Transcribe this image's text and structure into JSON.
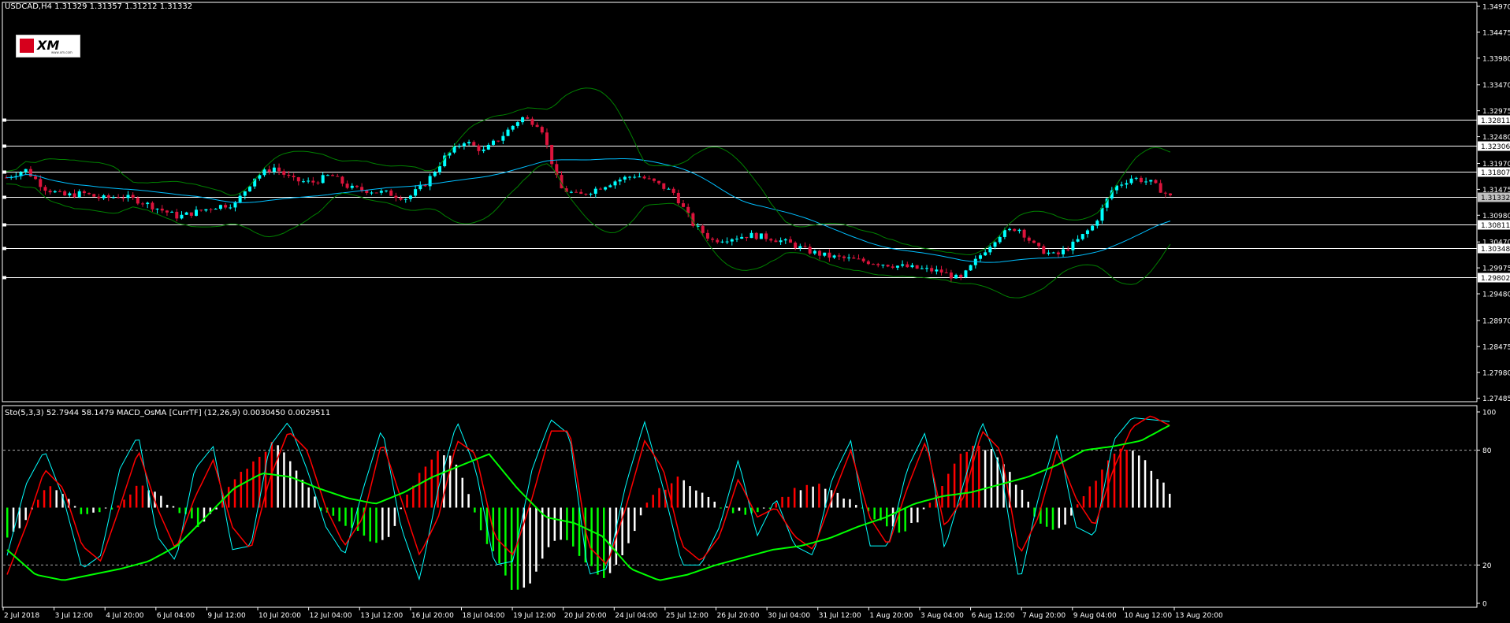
{
  "header": {
    "title": "USDCAD,H4  1.31329 1.31357 1.31212 1.31332",
    "indicator_title": "Sto(5,3,3) 52.7944 58.1479  MACD_OsMA [CurrTF] (12,26,9) 0.0030450 0.0029511",
    "logo_text": "XM",
    "logo_sub": "www.xm.com"
  },
  "chart_data": [
    {
      "type": "candlestick",
      "symbol": "USDCAD",
      "timeframe": "H4",
      "ylim": [
        1.2745,
        1.35
      ],
      "price_ticks": [
        "1.34970",
        "1.34475",
        "1.33980",
        "1.33470",
        "1.32975",
        "1.32480",
        "1.31970",
        "1.31475",
        "1.30980",
        "1.30470",
        "1.29975",
        "1.29480",
        "1.28970",
        "1.28475",
        "1.27980",
        "1.27485"
      ],
      "horizontal_levels": [
        "1.32811",
        "1.32306",
        "1.31807",
        "1.31332",
        "1.30811",
        "1.30348",
        "1.29802"
      ],
      "current_price": "1.31332",
      "x_labels": [
        "2 Jul 2018",
        "3 Jul 12:00",
        "4 Jul 20:00",
        "6 Jul 04:00",
        "9 Jul 12:00",
        "10 Jul 20:00",
        "12 Jul 04:00",
        "13 Jul 12:00",
        "16 Jul 20:00",
        "18 Jul 04:00",
        "19 Jul 12:00",
        "20 Jul 20:00",
        "24 Jul 04:00",
        "25 Jul 12:00",
        "26 Jul 20:00",
        "30 Jul 04:00",
        "31 Jul 12:00",
        "1 Aug 20:00",
        "3 Aug 04:00",
        "6 Aug 12:00",
        "7 Aug 20:00",
        "9 Aug 04:00",
        "10 Aug 12:00",
        "13 Aug 20:00"
      ],
      "close_path": [
        1.317,
        1.3185,
        1.315,
        1.3135,
        1.314,
        1.313,
        1.3135,
        1.3125,
        1.311,
        1.3095,
        1.3105,
        1.3115,
        1.312,
        1.317,
        1.319,
        1.3165,
        1.316,
        1.3175,
        1.315,
        1.3145,
        1.314,
        1.313,
        1.316,
        1.321,
        1.324,
        1.322,
        1.325,
        1.3285,
        1.327,
        1.315,
        1.3135,
        1.315,
        1.3165,
        1.3175,
        1.316,
        1.314,
        1.308,
        1.305,
        1.3055,
        1.306,
        1.3055,
        1.3045,
        1.303,
        1.302,
        1.3015,
        1.301,
        1.3005,
        1.3,
        1.2995,
        1.299,
        1.2975,
        1.302,
        1.306,
        1.3075,
        1.3035,
        1.302,
        1.3045,
        1.308,
        1.315,
        1.317,
        1.316,
        1.3133
      ],
      "colors": {
        "bull": "#00ffff",
        "bear": "#dc143c",
        "ma": "#00bfff",
        "bands": "#008000",
        "levels": "#ffffff"
      }
    },
    {
      "type": "oscillator",
      "name": "Sto(5,3,3) / MACD_OsMA",
      "ylim": [
        0,
        100
      ],
      "y_ticks": [
        "100",
        "80",
        "20",
        "0"
      ],
      "levels": [
        80,
        20
      ],
      "stoch_main": [
        25,
        62,
        80,
        55,
        18,
        25,
        70,
        88,
        35,
        22,
        70,
        82,
        28,
        30,
        82,
        95,
        70,
        40,
        25,
        60,
        92,
        40,
        12,
        60,
        95,
        70,
        20,
        22,
        70,
        96,
        88,
        15,
        18,
        62,
        95,
        60,
        20,
        20,
        40,
        75,
        35,
        55,
        30,
        25,
        65,
        85,
        30,
        30,
        70,
        90,
        28,
        62,
        95,
        70,
        10,
        55,
        88,
        40,
        35,
        85,
        97,
        96,
        95
      ],
      "stoch_signal": [
        15,
        40,
        70,
        60,
        30,
        22,
        50,
        80,
        50,
        28,
        55,
        75,
        40,
        28,
        65,
        90,
        80,
        50,
        30,
        45,
        85,
        55,
        25,
        45,
        85,
        78,
        35,
        25,
        55,
        90,
        90,
        30,
        20,
        50,
        85,
        70,
        30,
        22,
        35,
        65,
        45,
        50,
        35,
        28,
        55,
        80,
        45,
        30,
        60,
        85,
        40,
        55,
        90,
        80,
        25,
        45,
        80,
        55,
        40,
        70,
        92,
        98,
        93
      ],
      "macd_signal_line": [
        28,
        15,
        12,
        15,
        18,
        22,
        30,
        45,
        60,
        68,
        66,
        60,
        55,
        52,
        58,
        66,
        72,
        78,
        60,
        45,
        42,
        35,
        18,
        12,
        15,
        20,
        24,
        28,
        30,
        34,
        40,
        45,
        52,
        56,
        58,
        62,
        66,
        72,
        80,
        82,
        85,
        93
      ],
      "osma_histogram": [
        -15,
        -10,
        5,
        12,
        5,
        -3,
        -2,
        0,
        6,
        12,
        8,
        0,
        -5,
        -10,
        0,
        12,
        20,
        28,
        35,
        25,
        12,
        0,
        -5,
        -10,
        -15,
        -20,
        -10,
        10,
        22,
        30,
        25,
        5,
        -15,
        -30,
        -45,
        -40,
        -25,
        -15,
        -20,
        -30,
        -38,
        -30,
        -15,
        5,
        10,
        15,
        12,
        5,
        0,
        -3,
        -2,
        0,
        5,
        10,
        12,
        10,
        5,
        2,
        -5,
        -10,
        -12,
        -8,
        5,
        15,
        28,
        32,
        30,
        20,
        10,
        -5,
        -12,
        -10,
        5,
        15,
        25,
        32,
        28,
        18,
        8
      ],
      "colors": {
        "stoch_main": "#00ffff",
        "stoch_signal": "#ff0000",
        "macd_signal": "#00ff00",
        "hist_up": "#ff0000",
        "hist_up_weak": "#ffffff",
        "hist_down": "#00ff00",
        "hist_down_weak": "#ffffff"
      }
    }
  ]
}
